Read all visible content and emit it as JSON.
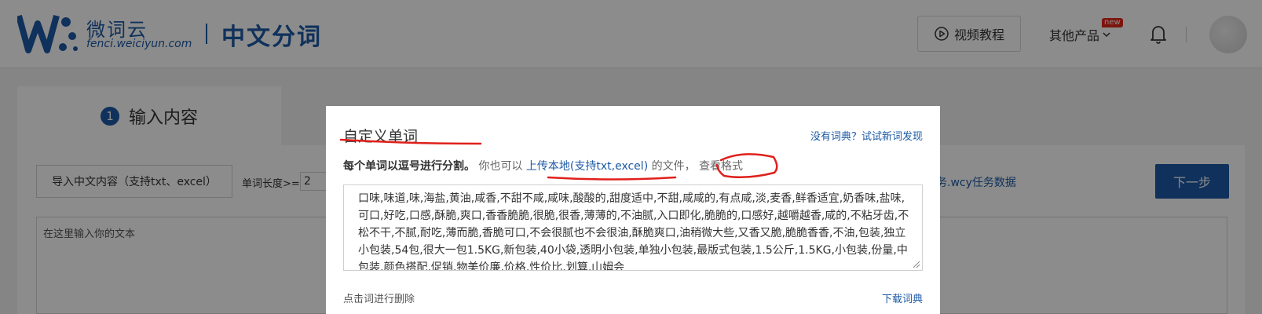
{
  "header": {
    "logo_cn": "微词云",
    "logo_url": "fenci.weiciyun.com",
    "product_title": "中文分词",
    "video_tutorial": "视频教程",
    "other_products": "其他产品",
    "new_badge": "new"
  },
  "page": {
    "step_number": "1",
    "step_label": "输入内容",
    "import_button": "导入中文内容（支持txt、excel）",
    "word_length_label": "单词长度>=",
    "word_length_value": "2",
    "task_link": "务.wcy任务数据",
    "next_button": "下一步",
    "textarea_placeholder": "在这里输入你的文本"
  },
  "modal": {
    "title": "自定义单词",
    "top_link": "没有词典？试试新词发现",
    "instruction_bold": "每个单词以逗号进行分割。",
    "instruction_pre": "你也可以",
    "upload_link": "上传本地(支持txt,excel)",
    "instruction_post": "的文件，",
    "view_format_link": "查看格式",
    "words_text": "口味,味道,味,海盐,黄油,咸香,不甜不咸,咸味,酸酸的,甜度适中,不甜,咸咸的,有点咸,淡,麦香,鲜香适宜,奶香味,盐味,可口,好吃,口感,酥脆,爽口,香香脆脆,很脆,很香,薄薄的,不油腻,入口即化,脆脆的,口感好,越嚼越香,咸的,不粘牙齿,不松不干,不腻,耐吃,薄而脆,香脆可口,不会很腻也不会很油,酥脆爽口,油稍微大些,又香又脆,脆脆香香,不油,包装,独立小包装,54包,很大一包1.5KG,新包装,40小袋,透明小包装,单独小包装,最版式包装,1.5公斤,1.5KG,小包装,份量,中包装,颜色搭配,促销,物美价廉,价格,性价比,划算,山姆会",
    "delete_hint": "点击词进行删除",
    "download_link": "下载词典"
  },
  "colors": {
    "brand_blue": "#1d5aa6",
    "annotation_red": "#e0201b"
  }
}
